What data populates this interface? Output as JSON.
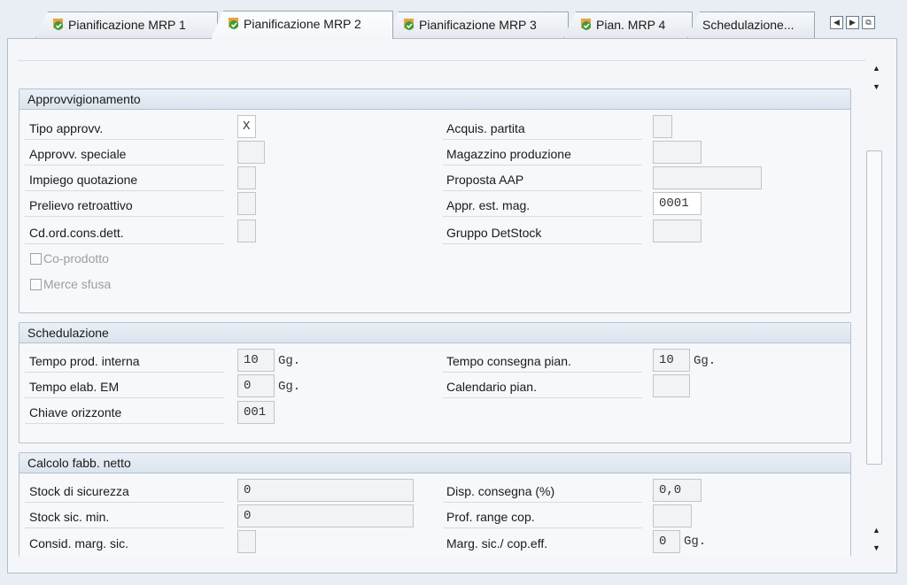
{
  "tabs": [
    {
      "label": "Pianificazione MRP 1"
    },
    {
      "label": "Pianificazione MRP 2"
    },
    {
      "label": "Pianificazione MRP 3"
    },
    {
      "label": "Pian. MRP 4"
    },
    {
      "label": "Schedulazione..."
    }
  ],
  "approvvigionamento": {
    "title": "Approvvigionamento",
    "tipo_approvv": {
      "label": "Tipo approvv.",
      "value": "X"
    },
    "approvv_speciale": {
      "label": "Approvv. speciale",
      "value": ""
    },
    "impiego_quotazione": {
      "label": "Impiego quotazione",
      "value": ""
    },
    "prelievo_retroattivo": {
      "label": "Prelievo retroattivo",
      "value": ""
    },
    "cd_ord_cons_dett": {
      "label": "Cd.ord.cons.dett.",
      "value": ""
    },
    "co_prodotto": {
      "label": "Co-prodotto",
      "checked": false
    },
    "merce_sfusa": {
      "label": "Merce sfusa",
      "checked": false
    },
    "acquis_partita": {
      "label": "Acquis. partita",
      "value": ""
    },
    "magazzino_produzione": {
      "label": "Magazzino produzione",
      "value": ""
    },
    "proposta_aap": {
      "label": "Proposta AAP",
      "value": ""
    },
    "appr_est_mag": {
      "label": "Appr. est. mag.",
      "value": "0001"
    },
    "gruppo_detstock": {
      "label": "Gruppo DetStock",
      "value": ""
    }
  },
  "schedulazione": {
    "title": "Schedulazione",
    "tempo_prod_interna": {
      "label": "Tempo prod. interna",
      "value": "10",
      "unit": "Gg."
    },
    "tempo_elab_em": {
      "label": "Tempo elab. EM",
      "value": "0",
      "unit": "Gg."
    },
    "chiave_orizzonte": {
      "label": "Chiave orizzonte",
      "value": "001"
    },
    "tempo_consegna_pian": {
      "label": "Tempo consegna pian.",
      "value": "10",
      "unit": "Gg."
    },
    "calendario_pian": {
      "label": "Calendario pian.",
      "value": ""
    }
  },
  "calcolo": {
    "title": "Calcolo fabb. netto",
    "stock_di_sicurezza": {
      "label": "Stock di sicurezza",
      "value": "0"
    },
    "stock_sic_min": {
      "label": "Stock sic. min.",
      "value": "0"
    },
    "consid_marg_sic": {
      "label": "Consid. marg. sic.",
      "value": ""
    },
    "disp_consegna": {
      "label": "Disp. consegna (%)",
      "value": "0,0"
    },
    "prof_range_cop": {
      "label": "Prof. range cop.",
      "value": ""
    },
    "marg_sic_cop_eff": {
      "label": "Marg. sic./ cop.eff.",
      "value": "0",
      "unit": "Gg."
    }
  },
  "colors": {
    "accent": "#3f7fbf",
    "panel": "#f4f6f9",
    "border": "#b5c2cf"
  }
}
